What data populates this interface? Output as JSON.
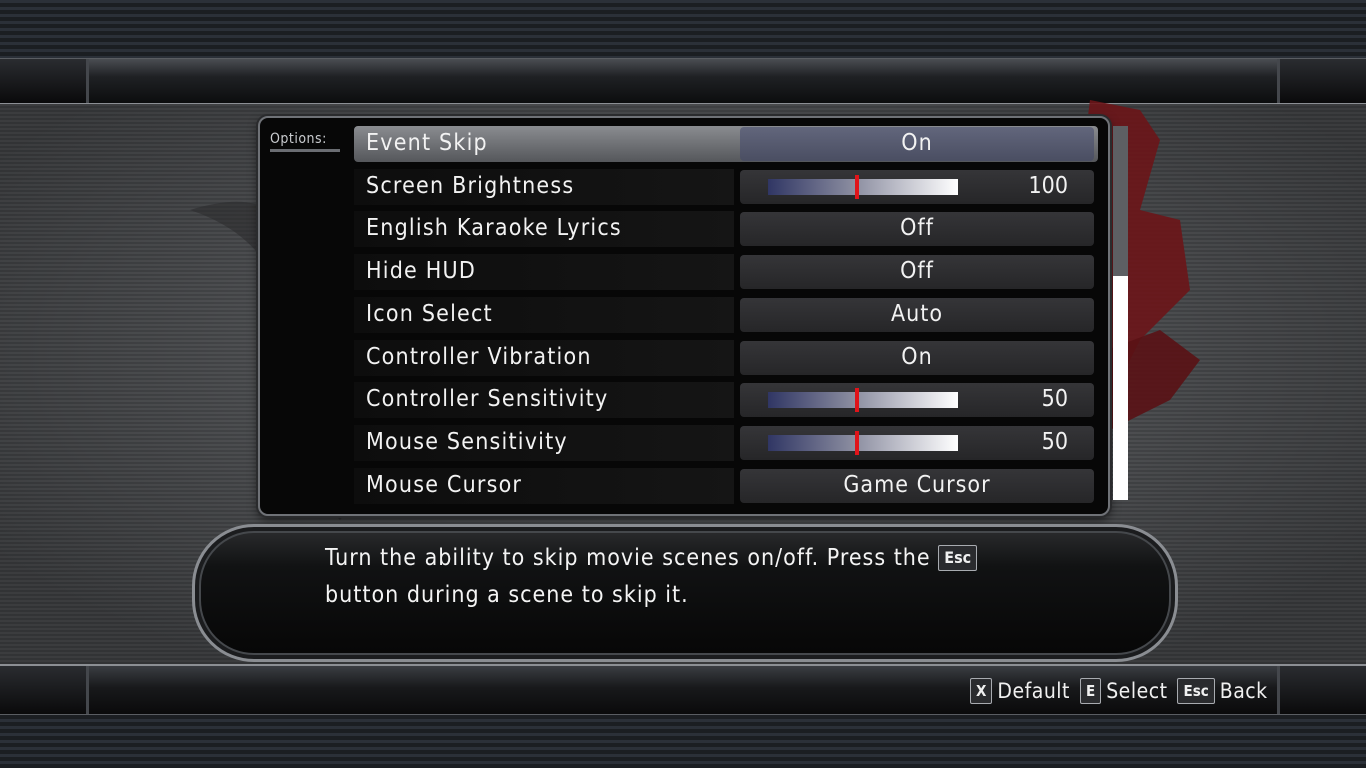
{
  "options_label": "Options:",
  "settings": [
    {
      "name": "Event Skip",
      "type": "toggle",
      "value": "On",
      "selected": true
    },
    {
      "name": "Screen Brightness",
      "type": "slider",
      "value": 100,
      "level": 0.47
    },
    {
      "name": "English Karaoke Lyrics",
      "type": "toggle",
      "value": "Off"
    },
    {
      "name": "Hide HUD",
      "type": "toggle",
      "value": "Off"
    },
    {
      "name": "Icon Select",
      "type": "toggle",
      "value": "Auto"
    },
    {
      "name": "Controller Vibration",
      "type": "toggle",
      "value": "On"
    },
    {
      "name": "Controller Sensitivity",
      "type": "slider",
      "value": 50,
      "level": 0.47
    },
    {
      "name": "Mouse Sensitivity",
      "type": "slider",
      "value": 50,
      "level": 0.47
    },
    {
      "name": "Mouse Cursor",
      "type": "toggle",
      "value": "Game Cursor"
    }
  ],
  "description": {
    "text_before": "Turn the ability to skip movie scenes on/off. Press the",
    "key": "Esc",
    "text_after": "button during a scene to skip it."
  },
  "hints": [
    {
      "key": "X",
      "label": "Default"
    },
    {
      "key": "E",
      "label": "Select"
    },
    {
      "key": "Esc",
      "label": "Back"
    }
  ],
  "colors": {
    "slider_marker": "#e0141a",
    "selected_value_bg": "#5a5e74",
    "watermark": "#6b1518"
  },
  "scroll_position": 0.4
}
